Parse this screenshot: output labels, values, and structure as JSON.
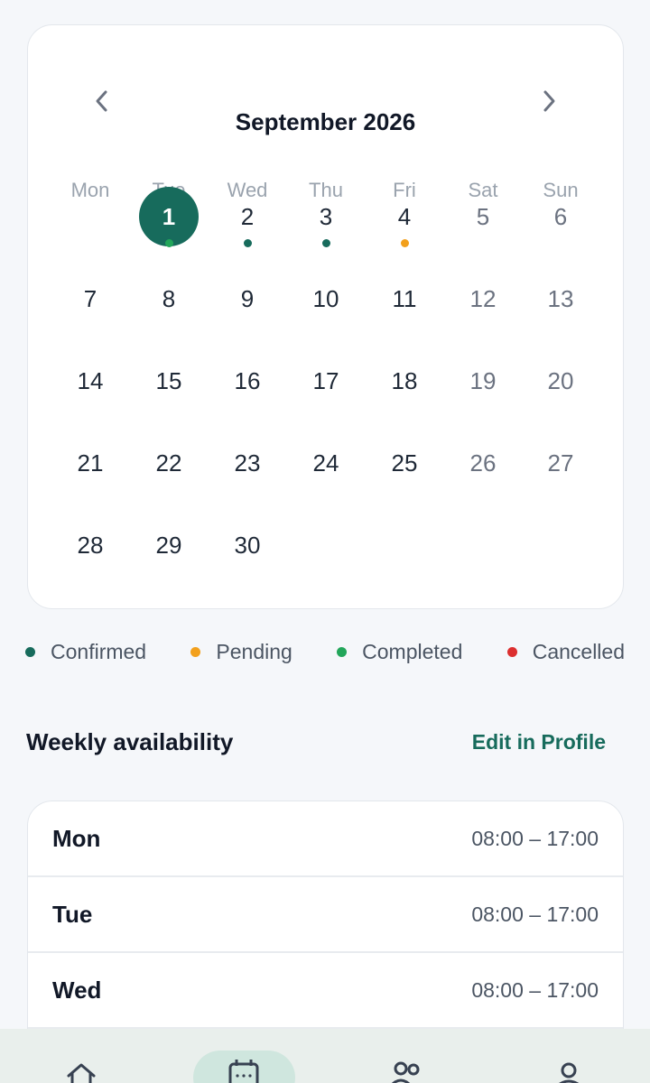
{
  "calendar": {
    "month_title": "September 2026",
    "prev_icon": "chevron-left-icon",
    "next_icon": "chevron-right-icon",
    "weekdays": [
      "Mon",
      "Tue",
      "Wed",
      "Thu",
      "Fri",
      "Sat",
      "Sun"
    ],
    "first_weekday_index": 1,
    "days_in_month": 30,
    "selected_day": 1,
    "markers": [
      {
        "day": 1,
        "status": "completed"
      },
      {
        "day": 2,
        "status": "confirmed"
      },
      {
        "day": 3,
        "status": "confirmed"
      },
      {
        "day": 4,
        "status": "pending"
      }
    ]
  },
  "legend": [
    {
      "key": "confirmed",
      "label": "Confirmed",
      "color": "#176b5c"
    },
    {
      "key": "pending",
      "label": "Pending",
      "color": "#f2a01c"
    },
    {
      "key": "completed",
      "label": "Completed",
      "color": "#22a65a"
    },
    {
      "key": "cancelled",
      "label": "Cancelled",
      "color": "#dc2f2f"
    }
  ],
  "availability": {
    "title": "Weekly availability",
    "edit_label": "Edit in Profile",
    "rows": [
      {
        "day": "Mon",
        "hours": "08:00 – 17:00"
      },
      {
        "day": "Tue",
        "hours": "08:00 – 17:00"
      },
      {
        "day": "Wed",
        "hours": "08:00 – 17:00"
      },
      {
        "day": "",
        "hours": ""
      }
    ]
  },
  "bottom_nav": {
    "items": [
      {
        "icon": "home-icon",
        "active": false
      },
      {
        "icon": "calendar-icon",
        "active": true
      },
      {
        "icon": "people-icon",
        "active": false
      },
      {
        "icon": "profile-icon",
        "active": false
      }
    ]
  },
  "colors": {
    "accent": "#176b5c",
    "selected_fill": "#176b5c",
    "nav_active_pill": "#cfe6de"
  }
}
